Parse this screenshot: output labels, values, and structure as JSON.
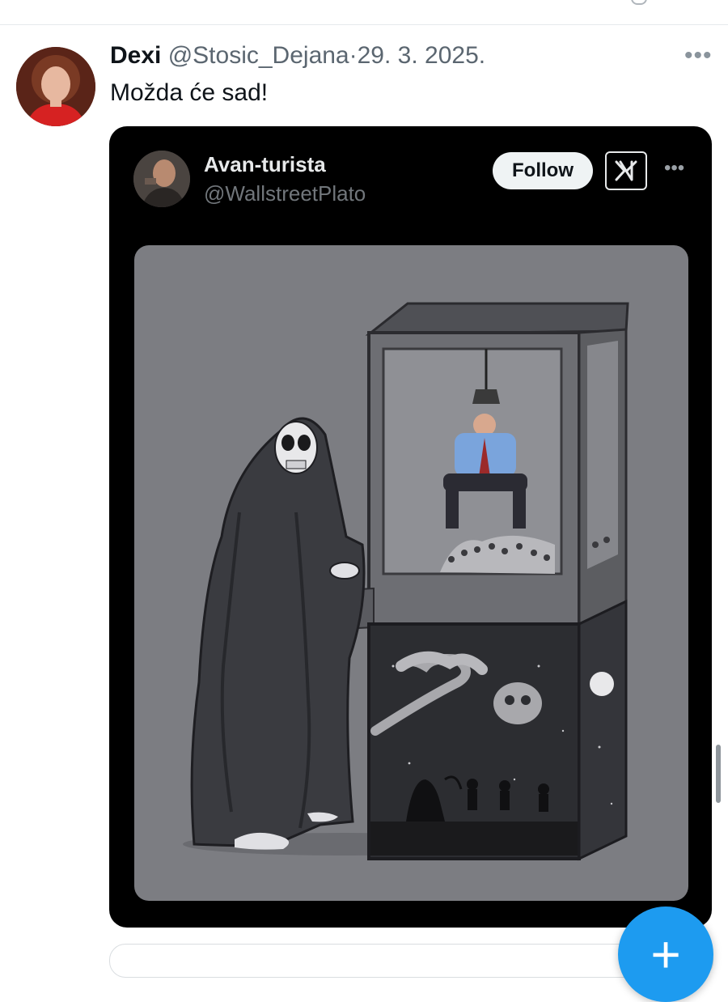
{
  "tweet": {
    "display_name": "Dexi",
    "handle": "@Stosic_Dejana",
    "separator": "·",
    "date": "29. 3. 2025.",
    "more_icon": "more-horizontal-icon",
    "text": "Možda će sad!"
  },
  "embed": {
    "display_name": "Avan-turista",
    "handle": "@WallstreetPlato",
    "follow_label": "Follow",
    "logo_icon": "x-logo-icon",
    "more_icon": "more-horizontal-icon",
    "image_icon": "grim-reaper-claw-machine-illustration"
  },
  "fab": {
    "icon": "compose-plus-icon",
    "label": "+"
  },
  "colors": {
    "accent": "#1d9bf0",
    "embed_bg": "#000000",
    "illustration_bg": "#7c7d82"
  }
}
